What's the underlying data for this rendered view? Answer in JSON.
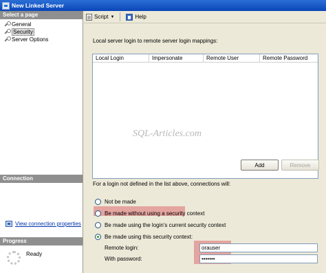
{
  "window": {
    "title": "New Linked Server"
  },
  "sidebar": {
    "header": "Select a page",
    "items": [
      {
        "label": "General"
      },
      {
        "label": "Security"
      },
      {
        "label": "Server Options"
      }
    ],
    "connection_header": "Connection",
    "connection_link": "View connection properties",
    "progress_header": "Progress",
    "progress_status": "Ready"
  },
  "toolbar": {
    "script_label": "Script",
    "help_label": "Help"
  },
  "main": {
    "heading": "Local server login to remote server login mappings:",
    "columns": [
      "Local Login",
      "Impersonate",
      "Remote User",
      "Remote Password"
    ],
    "watermark": "SQL-Articles.com",
    "add_label": "Add",
    "remove_label": "Remove",
    "explain": "For a login not defined in the list above, connections will:",
    "options": [
      {
        "label": "Not be made",
        "selected": false
      },
      {
        "label": "Be made without using a security context",
        "selected": false
      },
      {
        "label": "Be made using the login's current security context",
        "selected": false
      },
      {
        "label": "Be made using this security context:",
        "selected": true
      }
    ],
    "remote_login_label": "Remote login:",
    "remote_login_value": "orauser",
    "password_label": "With password:",
    "password_value": "•••••••"
  },
  "colors": {
    "title_bar": "#0a46b8",
    "highlight": "#dc505a",
    "link": "#0033aa"
  }
}
